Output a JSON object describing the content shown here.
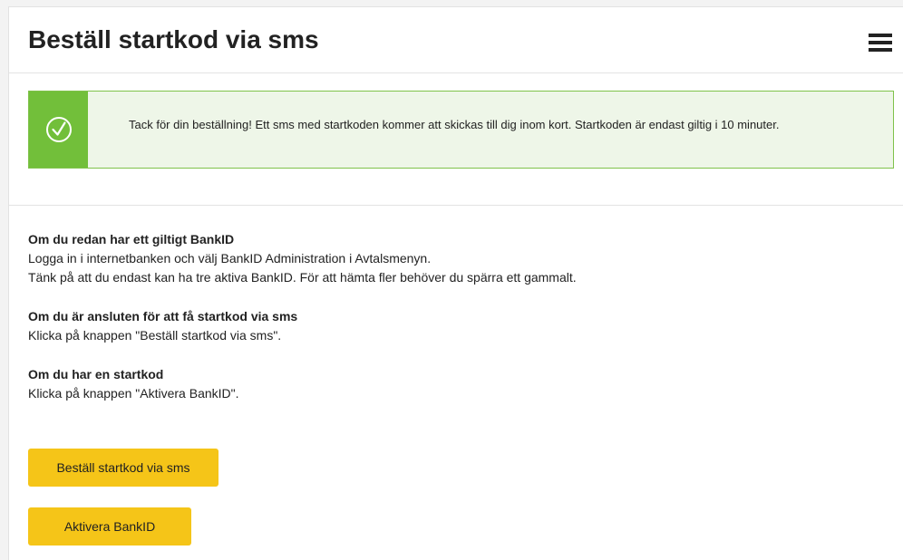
{
  "header": {
    "title": "Beställ startkod via sms",
    "menu_icon": "hamburger-menu-icon"
  },
  "alert": {
    "icon": "check-circle-icon",
    "message": "Tack för din beställning! Ett sms med startkoden kommer att skickas till dig inom kort. Startkoden är endast giltig i 10 minuter."
  },
  "sections": [
    {
      "heading": "Om du redan har ett giltigt BankID",
      "lines": [
        "Logga in i internetbanken och välj BankID Administration i Avtalsmenyn.",
        "Tänk på att du endast kan ha tre aktiva BankID. För att hämta fler behöver du spärra ett gammalt."
      ]
    },
    {
      "heading": "Om du är ansluten för att få startkod via sms",
      "lines": [
        "Klicka på knappen \"Beställ startkod via sms\"."
      ]
    },
    {
      "heading": "Om du har en startkod",
      "lines": [
        "Klicka på knappen \"Aktivera BankID\"."
      ]
    }
  ],
  "buttons": {
    "order_label": "Beställ startkod via sms",
    "activate_label": "Aktivera BankID"
  },
  "colors": {
    "accent_yellow": "#f5c518",
    "success_green": "#72bf3a",
    "success_bg": "#eef6e8"
  }
}
